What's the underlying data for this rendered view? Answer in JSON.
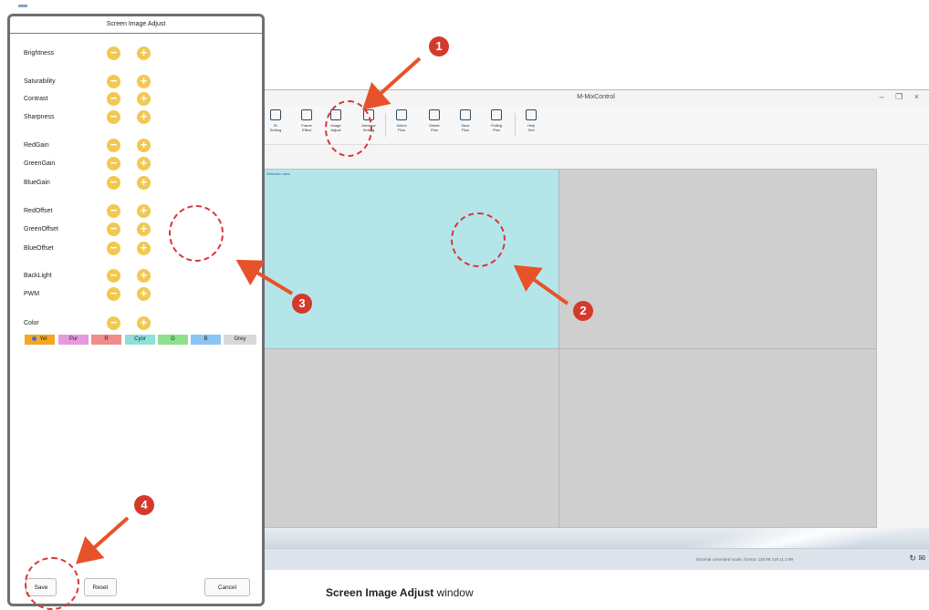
{
  "app": {
    "title": "M-MixControl",
    "window_controls": "– ❐ ×",
    "toolbar": [
      {
        "icon": "id-setting-icon",
        "label": "ID\nSetting"
      },
      {
        "icon": "frame-effect-icon",
        "label": "Frame\nEffect"
      },
      {
        "icon": "image-adjust-icon",
        "label": "Image\nAdjust"
      },
      {
        "icon": "advance-setting-icon",
        "label": "Advance\nSetting"
      },
      {
        "icon": "select-plan-icon",
        "label": "Select\nPlan"
      },
      {
        "icon": "delete-plan-icon",
        "label": "Delete\nPlan"
      },
      {
        "icon": "save-plan-icon",
        "label": "Save\nPlan"
      },
      {
        "icon": "polling-plan-icon",
        "label": "Polling\nPlan"
      },
      {
        "icon": "help-text-icon",
        "label": "Help\nText"
      }
    ],
    "selection_label": "Selection area",
    "status_text": "Decimal command mode, format: 128 89 216 11 2 99"
  },
  "dialog": {
    "title": "Screen Image Adjust",
    "rows": [
      {
        "label": "Brightness"
      },
      {
        "label": "Saturability"
      },
      {
        "label": "Contrast"
      },
      {
        "label": "Sharpness"
      },
      {
        "label": "RedGain"
      },
      {
        "label": "GreenGain"
      },
      {
        "label": "BlueGain"
      },
      {
        "label": "RedOffset"
      },
      {
        "label": "GreenOffset"
      },
      {
        "label": "BlueOffset"
      },
      {
        "label": "BackLight"
      },
      {
        "label": "PWM"
      },
      {
        "label": "Color"
      }
    ],
    "minus_symbol": "−",
    "plus_symbol": "+",
    "colors": [
      {
        "label": "Yel",
        "color": "#f5a623",
        "selected": true
      },
      {
        "label": "Pur",
        "color": "#e59ae0",
        "selected": false
      },
      {
        "label": "R",
        "color": "#f08c8c",
        "selected": false
      },
      {
        "label": "Cyor",
        "color": "#8fe0d8",
        "selected": false
      },
      {
        "label": "G",
        "color": "#8fe08f",
        "selected": false
      },
      {
        "label": "B",
        "color": "#8cc4f2",
        "selected": false
      },
      {
        "label": "Grey",
        "color": "#d9d9d9",
        "selected": false
      }
    ],
    "buttons": {
      "save": "Save",
      "reset": "Reset",
      "cancel": "Cancel"
    }
  },
  "callouts": [
    "1",
    "2",
    "3",
    "4"
  ],
  "caption": {
    "bold": "Screen Image Adjust",
    "rest": " window"
  },
  "colors": {
    "accent": "#f3c84f",
    "callout": "#d33a2c",
    "arrow": "#e8522a",
    "selection": "#b4e6e9"
  }
}
